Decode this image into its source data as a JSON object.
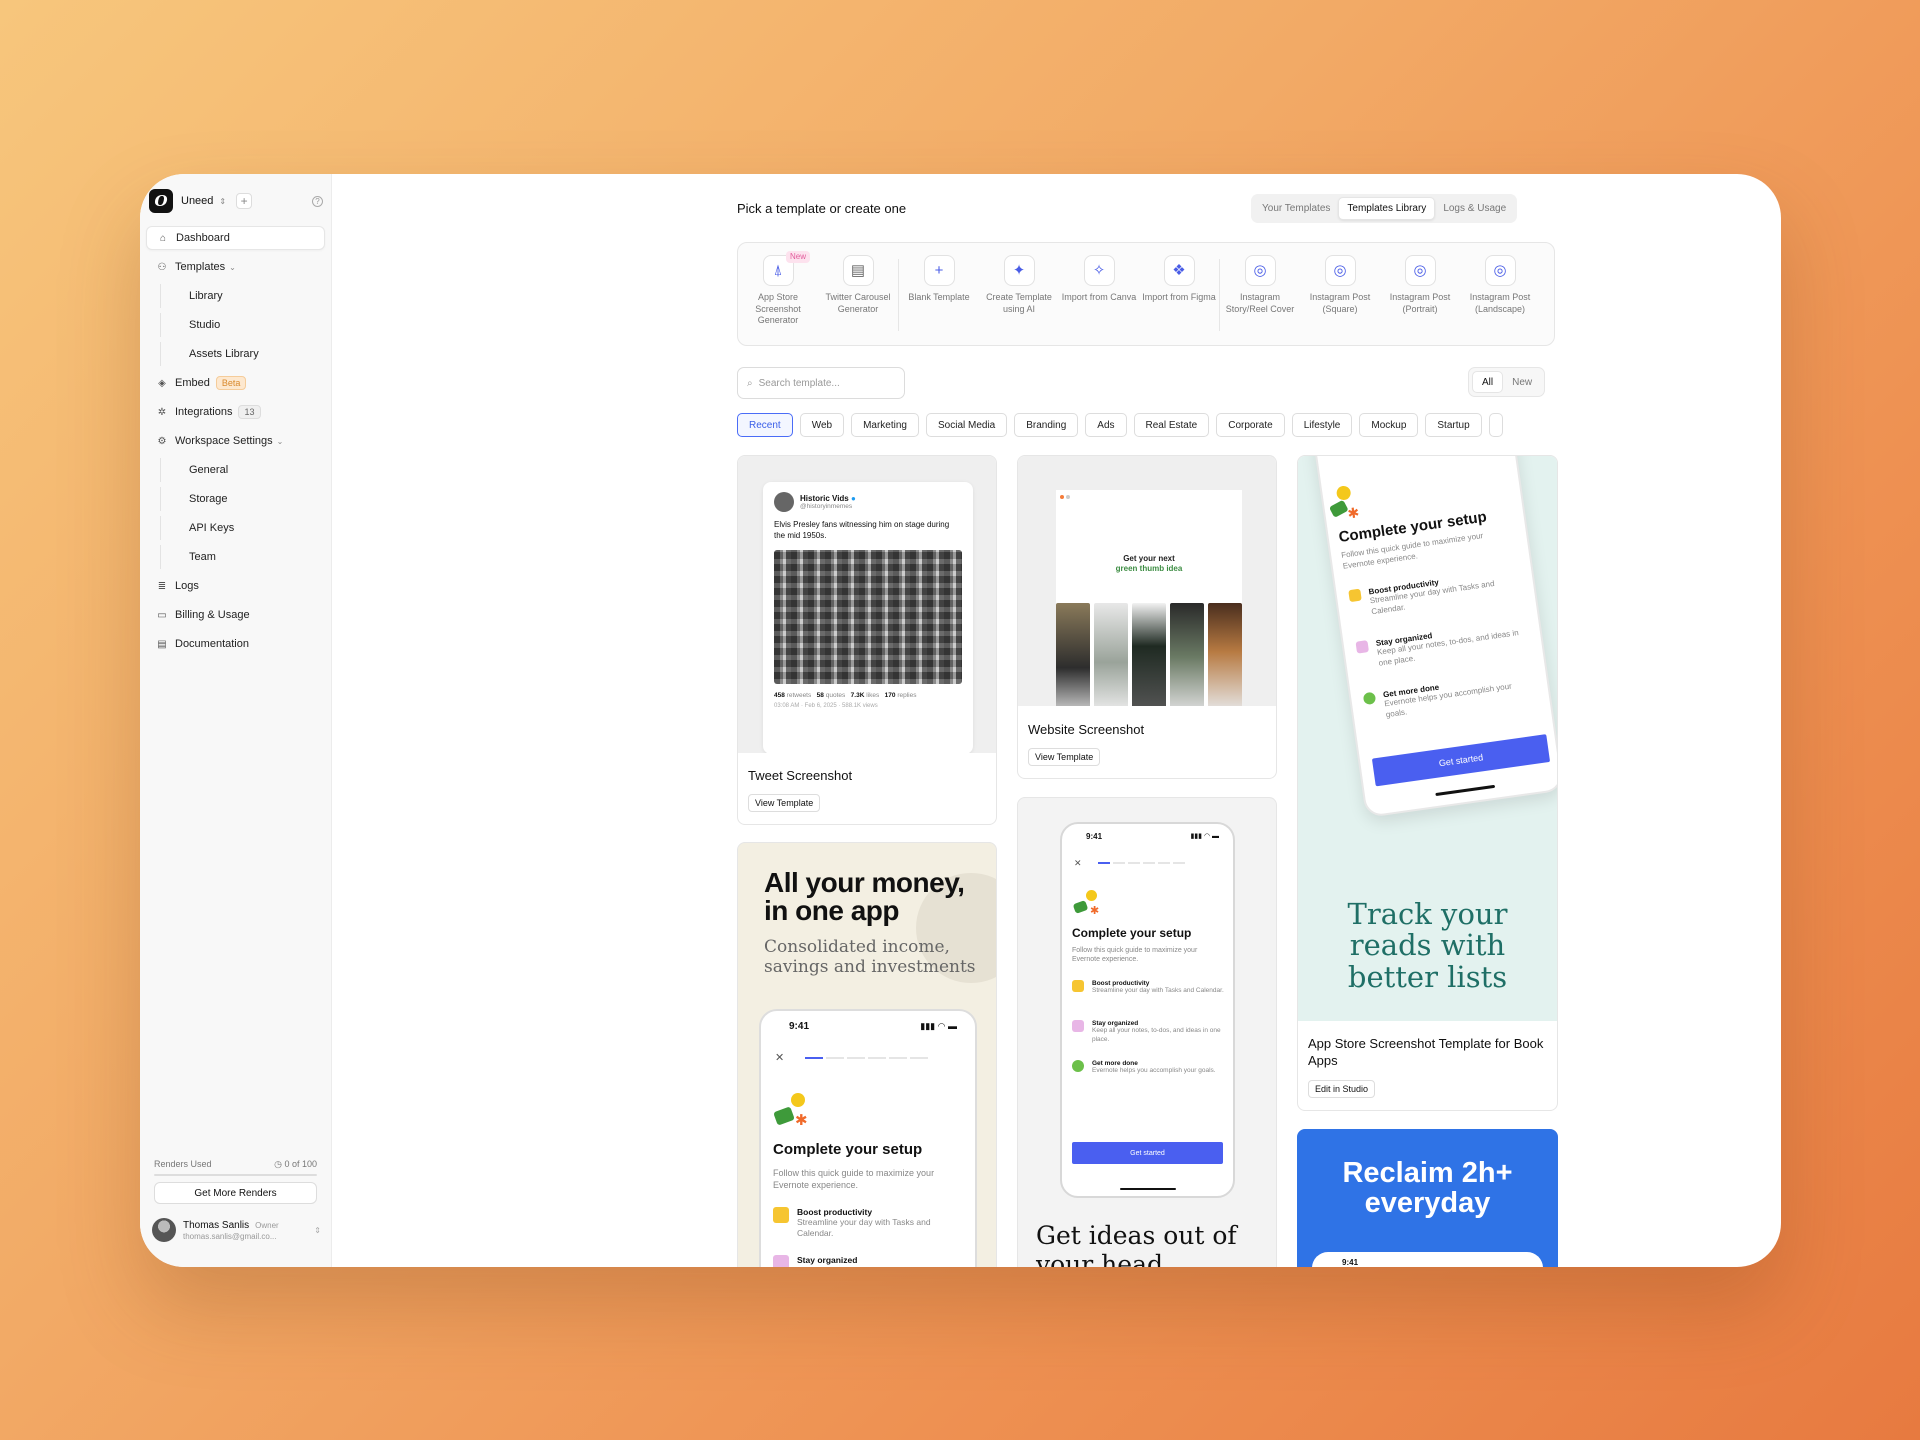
{
  "workspace": {
    "name": "Uneed",
    "plus": "+",
    "help": "?"
  },
  "nav": {
    "dashboard": "Dashboard",
    "templates": "Templates",
    "library": "Library",
    "studio": "Studio",
    "assets": "Assets Library",
    "embed": "Embed",
    "beta": "Beta",
    "integrations": "Integrations",
    "integrations_count": "13",
    "workspace_settings": "Workspace Settings",
    "general": "General",
    "storage": "Storage",
    "api_keys": "API Keys",
    "team": "Team",
    "logs": "Logs",
    "billing": "Billing & Usage",
    "documentation": "Documentation"
  },
  "renders": {
    "label": "Renders Used",
    "value": "0 of 100",
    "progress": 0,
    "button": "Get More Renders"
  },
  "user": {
    "name": "Thomas Sanlis",
    "role": "Owner",
    "email": "thomas.sanlis@gmail.co..."
  },
  "header": {
    "title": "Pick a template or create one",
    "tabs": [
      "Your Templates",
      "Templates Library",
      "Logs & Usage"
    ],
    "active_tab": "Templates Library"
  },
  "tools": [
    {
      "label": "App Store Screenshot Generator",
      "badge": "New"
    },
    {
      "label": "Twitter Carousel Generator"
    },
    {
      "label": "Blank Template"
    },
    {
      "label": "Create Template using AI"
    },
    {
      "label": "Import from Canva"
    },
    {
      "label": "Import from Figma"
    },
    {
      "label": "Instagram Story/Reel Cover"
    },
    {
      "label": "Instagram Post (Square)"
    },
    {
      "label": "Instagram Post (Portrait)"
    },
    {
      "label": "Instagram Post (Landscape)"
    }
  ],
  "search": {
    "placeholder": "Search template..."
  },
  "filter_toggle": {
    "all": "All",
    "new": "New"
  },
  "categories": [
    "Recent",
    "Web",
    "Marketing",
    "Social Media",
    "Branding",
    "Ads",
    "Real Estate",
    "Corporate",
    "Lifestyle",
    "Mockup",
    "Startup"
  ],
  "cards": {
    "tweet": {
      "title": "Tweet Screenshot",
      "button": "View Template",
      "tw_name": "Historic Vids",
      "tw_handle": "@historyinmemes",
      "tw_text": "Elvis Presley fans witnessing him on stage during the mid 1950s.",
      "retweets": "458",
      "retweets_label": "retweets",
      "quotes": "58",
      "quotes_label": "quotes",
      "likes": "7.3K",
      "likes_label": "likes",
      "replies": "170",
      "replies_label": "replies",
      "time": "03:08 AM · Feb 6, 2025 · 588.1K views"
    },
    "website": {
      "title": "Website Screenshot",
      "button": "View Template",
      "headline_1": "Get your next",
      "headline_2": "green thumb idea"
    },
    "appstore": {
      "title": "App Store Screenshot Template for Book Apps",
      "button": "Edit in Studio",
      "headline": "Track your reads with better lists"
    },
    "money": {
      "headline": "All your money, in one app",
      "sub": "Consolidated income, savings and investments"
    },
    "ideas": {
      "headline": "Get ideas out of your head"
    },
    "reclaim": {
      "headline": "Reclaim 2h+ everyday"
    },
    "setup": {
      "time": "9:41",
      "title": "Complete your setup",
      "subtitle": "Follow this quick guide to maximize your Evernote experience.",
      "item1_title": "Boost productivity",
      "item1_sub": "Streamline your day with Tasks and Calendar.",
      "item2_title": "Stay organized",
      "item2_sub": "Keep all your notes, to-dos, and ideas in one place.",
      "item3_title": "Get more done",
      "item3_sub": "Evernote helps you accomplish your goals.",
      "cta": "Get started"
    }
  },
  "colors": {
    "accent": "#4a5ff0",
    "brand_green": "#1f6f66",
    "reclaim_blue": "#2f73e6"
  }
}
